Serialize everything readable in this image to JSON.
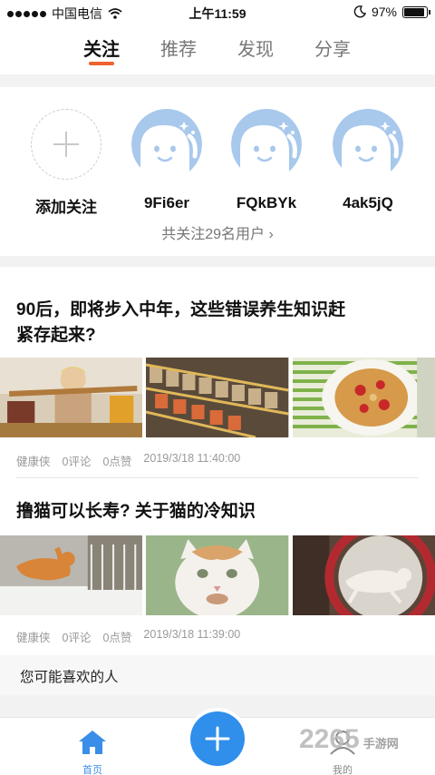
{
  "status": {
    "carrier": "中国电信",
    "time": "上午11:59",
    "battery": "97%",
    "battery_level": 0.97
  },
  "tabs": [
    {
      "label": "关注",
      "active": true
    },
    {
      "label": "推荐",
      "active": false
    },
    {
      "label": "发现",
      "active": false
    },
    {
      "label": "分享",
      "active": false
    }
  ],
  "follow": {
    "add_label": "添加关注",
    "users": [
      "9Fi6er",
      "FQkBYk",
      "4ak5jQ"
    ],
    "total_text": "共关注29名用户",
    "avatar_color": "#a8c8ec"
  },
  "articles": [
    {
      "title_line1": "90后，即将步入中年，这些错误养生知识赶",
      "title_line2": "紧存起来?",
      "source": "健康侠",
      "comments": "0评论",
      "likes": "0点赞",
      "date": "2019/3/18 11:40:00"
    },
    {
      "title_line1": "撸猫可以长寿? 关于猫的冷知识",
      "source": "健康侠",
      "comments": "0评论",
      "likes": "0点赞",
      "date": "2019/3/18 11:39:00"
    }
  ],
  "maybe_like": "您可能喜欢的人",
  "nav": {
    "home": "首页",
    "mine": "我的",
    "accent": "#2f8fea"
  },
  "watermark": {
    "text": "2265",
    "sub": "手游网"
  }
}
